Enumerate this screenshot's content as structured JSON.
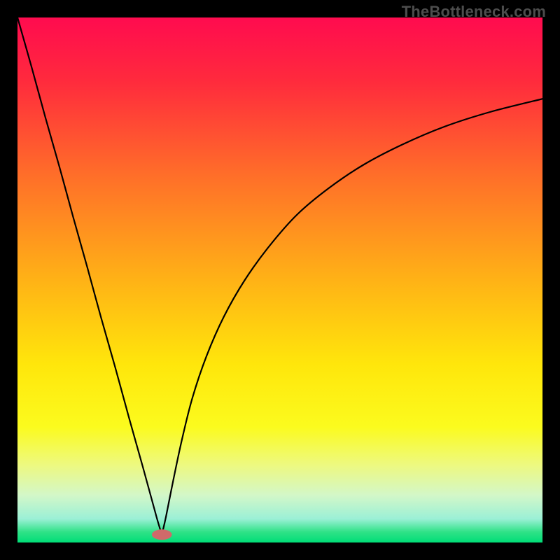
{
  "watermark": "TheBottleneck.com",
  "chart_data": {
    "type": "line",
    "title": "",
    "xlabel": "",
    "ylabel": "",
    "xlim": [
      0,
      100
    ],
    "ylim": [
      0,
      100
    ],
    "grid": false,
    "legend": false,
    "background_gradient_stops": [
      {
        "pos": 0.0,
        "color": "#ff0b4f"
      },
      {
        "pos": 0.12,
        "color": "#ff2a3d"
      },
      {
        "pos": 0.3,
        "color": "#ff6e29"
      },
      {
        "pos": 0.5,
        "color": "#ffb216"
      },
      {
        "pos": 0.66,
        "color": "#ffe60b"
      },
      {
        "pos": 0.78,
        "color": "#fbfb1e"
      },
      {
        "pos": 0.85,
        "color": "#eef97d"
      },
      {
        "pos": 0.91,
        "color": "#d3f7c8"
      },
      {
        "pos": 0.955,
        "color": "#9bf0d6"
      },
      {
        "pos": 0.98,
        "color": "#2fe287"
      },
      {
        "pos": 1.0,
        "color": "#00dd77"
      }
    ],
    "series": [
      {
        "name": "left-branch",
        "x": [
          0.0,
          2.7,
          5.3,
          8.0,
          10.6,
          13.3,
          15.9,
          18.6,
          21.2,
          23.9,
          26.5,
          27.5
        ],
        "y": [
          100.0,
          90.5,
          81.0,
          71.5,
          62.0,
          52.4,
          42.9,
          33.4,
          23.9,
          14.3,
          4.8,
          1.5
        ]
      },
      {
        "name": "right-branch",
        "x": [
          27.5,
          28.3,
          29.7,
          31.3,
          33.3,
          36.0,
          39.3,
          43.3,
          48.0,
          53.3,
          59.3,
          66.0,
          73.3,
          81.3,
          90.0,
          100.0
        ],
        "y": [
          1.5,
          5.0,
          12.0,
          19.5,
          27.5,
          35.5,
          43.0,
          50.0,
          56.5,
          62.5,
          67.5,
          72.0,
          75.8,
          79.2,
          82.0,
          84.5
        ]
      }
    ],
    "marker": {
      "name": "bottleneck-point",
      "x": 27.5,
      "y": 1.5,
      "rx_pct": 1.9,
      "ry_pct": 1.0,
      "fill": "#cf6a6a"
    }
  }
}
